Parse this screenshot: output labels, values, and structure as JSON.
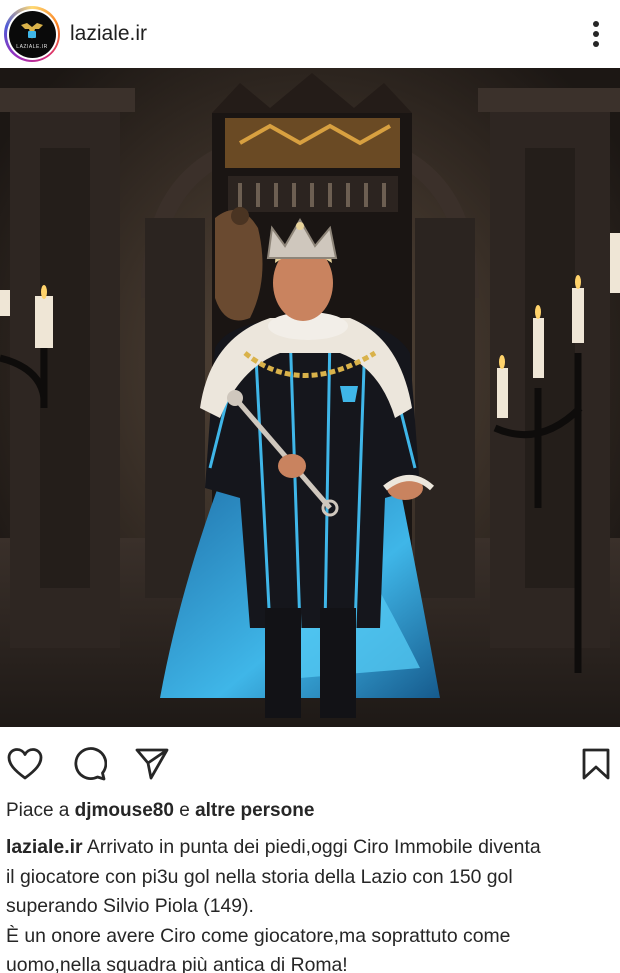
{
  "account": {
    "username": "laziale.ir",
    "avatar_text": "LAZIALE.IR"
  },
  "icons": {
    "more": "more-vertical-icon",
    "like": "heart-icon",
    "comment": "comment-icon",
    "share": "send-icon",
    "save": "bookmark-icon"
  },
  "likes": {
    "prefix": "Piace a",
    "user": "djmouse80",
    "conjunction": "e",
    "others": "altre persone"
  },
  "caption": {
    "user": "laziale.ir",
    "line1": "Arrivato in punta dei piedi,oggi Ciro Immobile diventa",
    "line2": "il giocatore con pi3u gol nella storia della Lazio con 150 gol",
    "line3": "superando Silvio Piola (149).",
    "line4": "È un onore avere Ciro come giocatore,ma soprattuto come",
    "line5": "uomo,nella squadra più antica di Roma!"
  },
  "colors": {
    "text": "#262626",
    "lazio_blue": "#3fb6e8"
  }
}
